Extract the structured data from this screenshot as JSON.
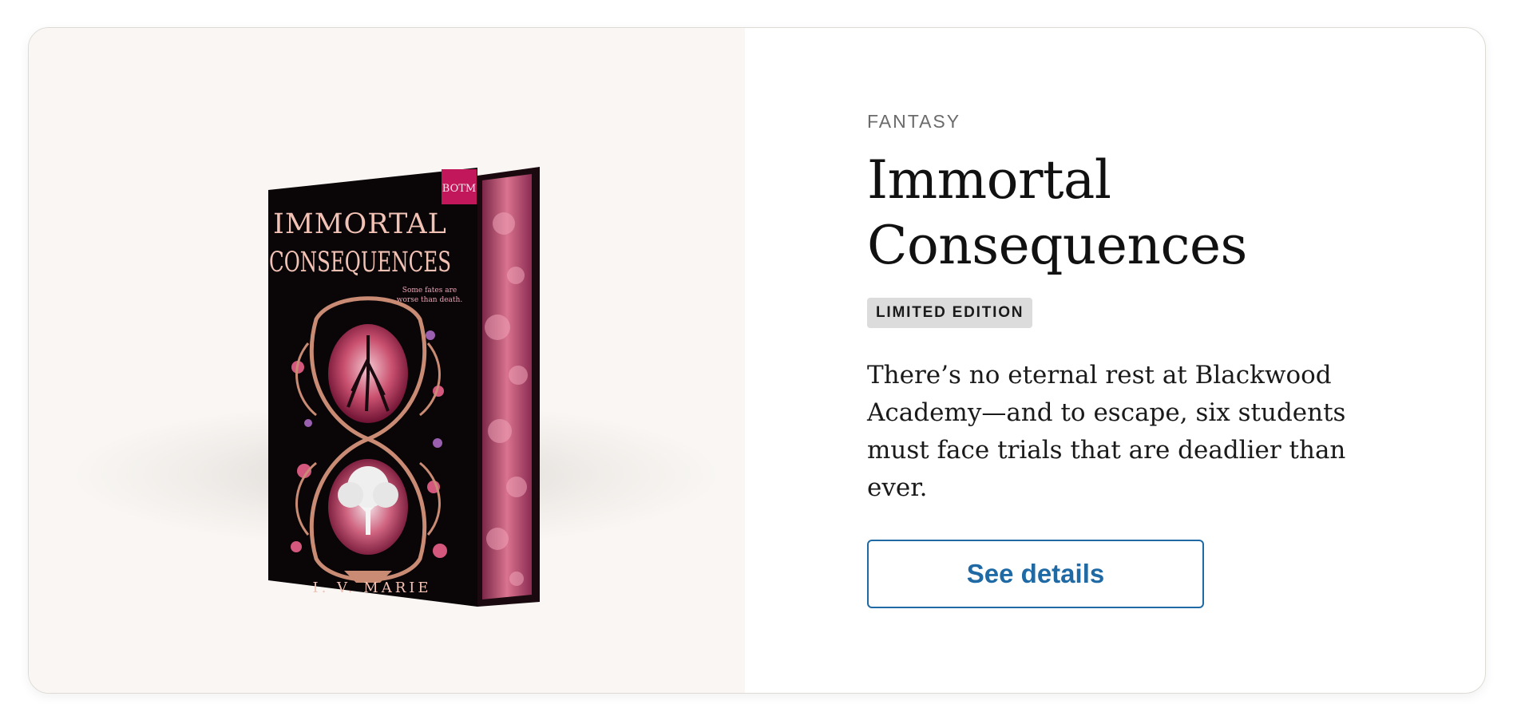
{
  "product": {
    "genre": "FANTASY",
    "title": "Immortal Consequences",
    "badge": "LIMITED EDITION",
    "description": "There’s no eternal rest at Blackwood Academy—and to escape, six students must face trials that are deadlier than ever.",
    "cta_label": "See details"
  },
  "cover": {
    "title_line1": "IMMORTAL",
    "title_line2": "CONSEQUENCES",
    "tagline_line1": "Some fates are",
    "tagline_line2": "worse than death.",
    "author": "I. V. MARIE",
    "publisher_logo": "BOTM"
  },
  "colors": {
    "accent": "#1f6aa5",
    "cover_pink": "#c2185b",
    "badge_bg": "#dcdcdc"
  }
}
